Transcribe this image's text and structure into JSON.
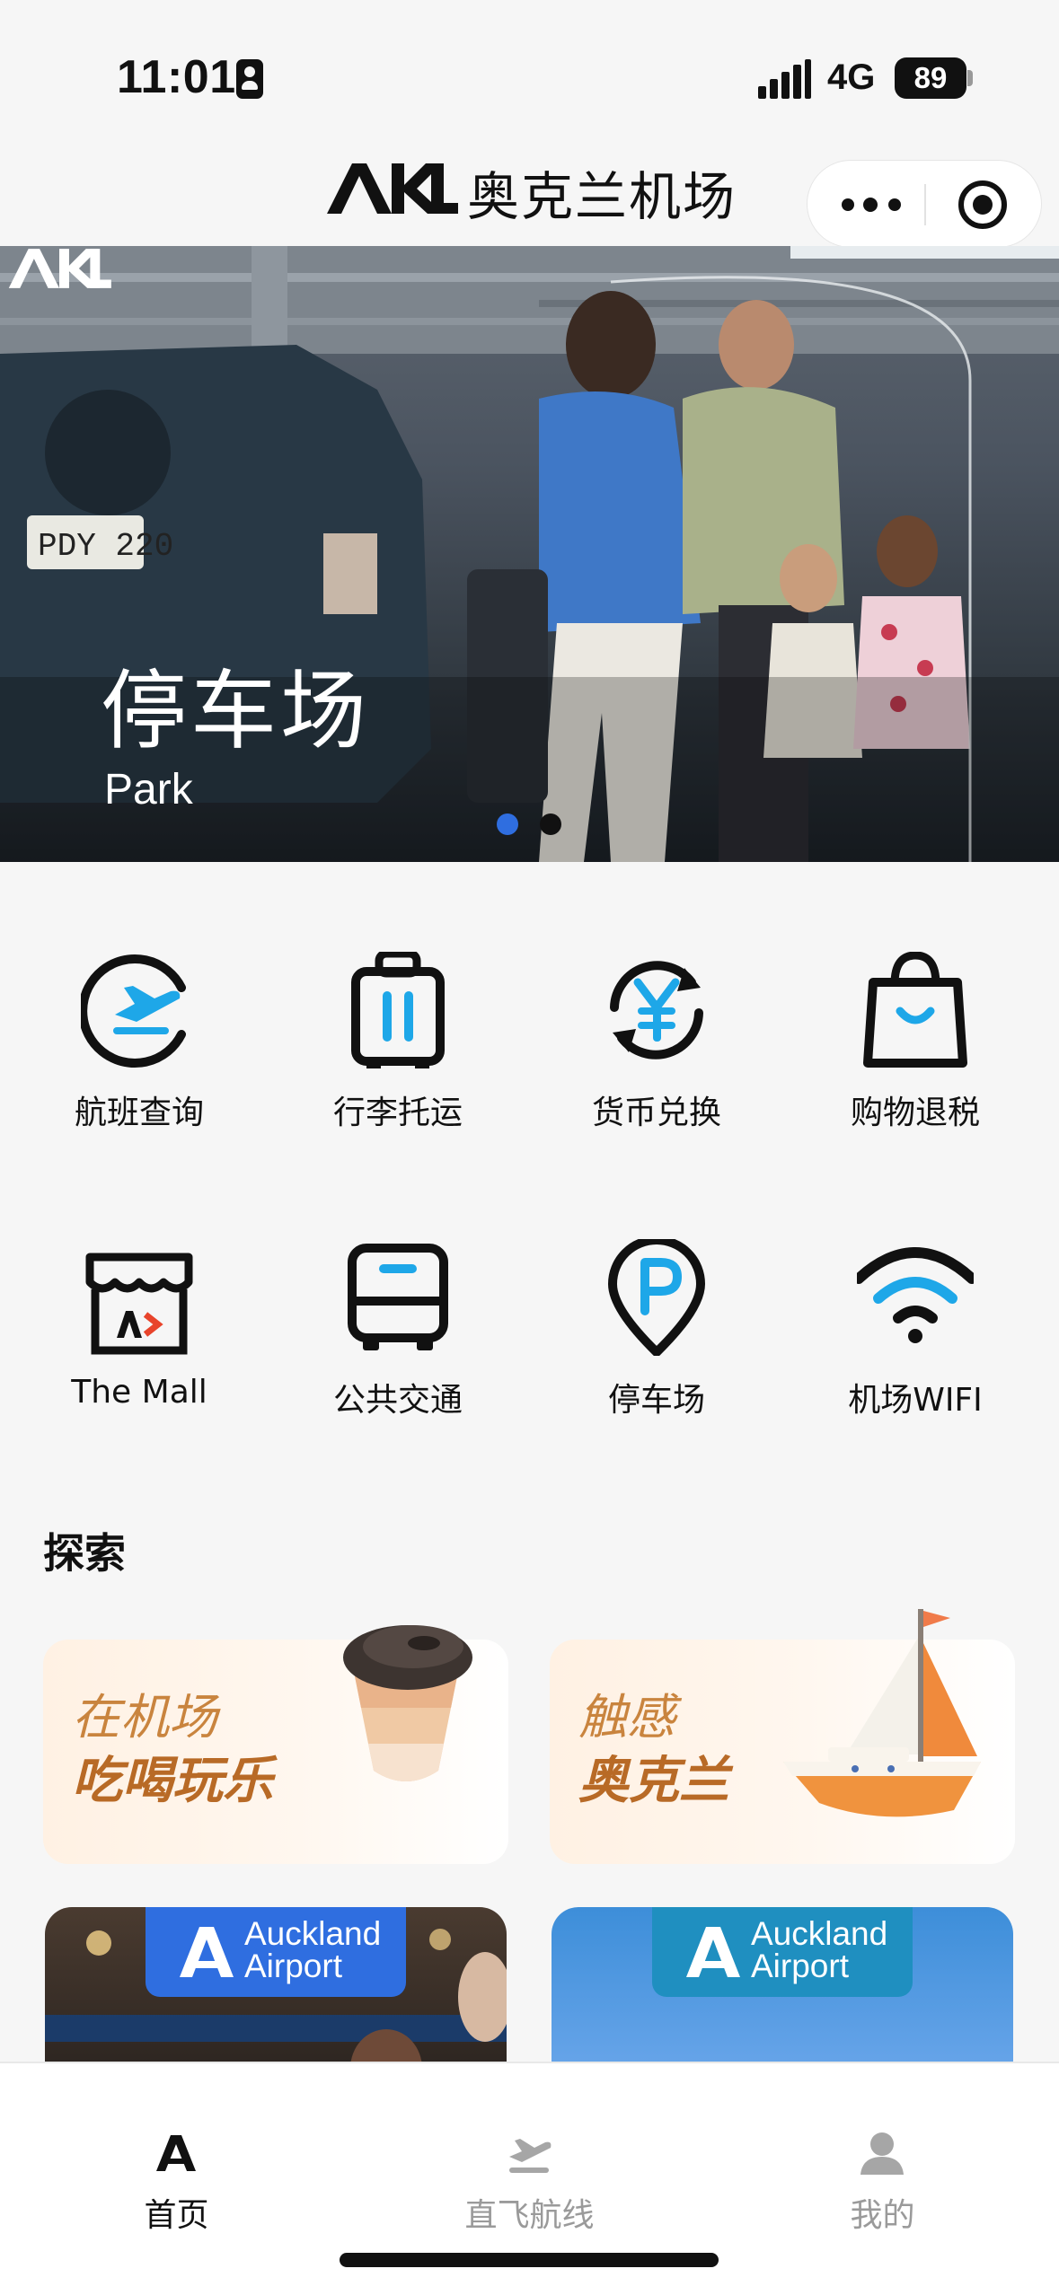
{
  "status_bar": {
    "time": "11:01",
    "network": "4G",
    "battery": "89"
  },
  "header": {
    "logo_text": "AKL",
    "title": "奥克兰机场",
    "more_icon": "more-dots-icon",
    "close_icon": "target-close-icon"
  },
  "banner": {
    "title": "停车场",
    "subtitle_prefix": "Park",
    "subtitle_logo": "AKL",
    "slides": 2,
    "active_slide": 1
  },
  "services": [
    {
      "label": "航班查询",
      "icon": "flight-search-icon"
    },
    {
      "label": "行李托运",
      "icon": "luggage-icon"
    },
    {
      "label": "货币兑换",
      "icon": "currency-exchange-icon"
    },
    {
      "label": "购物退税",
      "icon": "shopping-bag-icon"
    },
    {
      "label": "The Mall",
      "icon": "mall-store-icon"
    },
    {
      "label": "公共交通",
      "icon": "bus-icon"
    },
    {
      "label": "停车场",
      "icon": "parking-pin-icon"
    },
    {
      "label": "机场WIFI",
      "icon": "wifi-icon"
    }
  ],
  "explore": {
    "title": "探索",
    "cards": [
      {
        "line1": "在机场",
        "line2": "吃喝玩乐",
        "icon": "coffee-cup-icon"
      },
      {
        "line1": "触感",
        "line2": "奥克兰",
        "icon": "sailboat-icon"
      }
    ]
  },
  "promos": [
    {
      "badge_line1": "Auckland",
      "badge_line2": "Airport",
      "badge_color": "#2f6ee0"
    },
    {
      "badge_line1": "Auckland",
      "badge_line2": "Airport",
      "badge_color": "#1f8fc0"
    }
  ],
  "tab_bar": {
    "tabs": [
      {
        "label": "首页",
        "icon": "home-a-icon",
        "active": true
      },
      {
        "label": "直飞航线",
        "icon": "direct-flight-icon",
        "active": false
      },
      {
        "label": "我的",
        "icon": "profile-icon",
        "active": false
      }
    ]
  },
  "colors": {
    "accent_blue": "#1ea7e8",
    "dot_active": "#2f6ee0",
    "explore_text": "#c9843e",
    "tab_active": "#111111",
    "tab_inactive": "#9a9a9a"
  }
}
